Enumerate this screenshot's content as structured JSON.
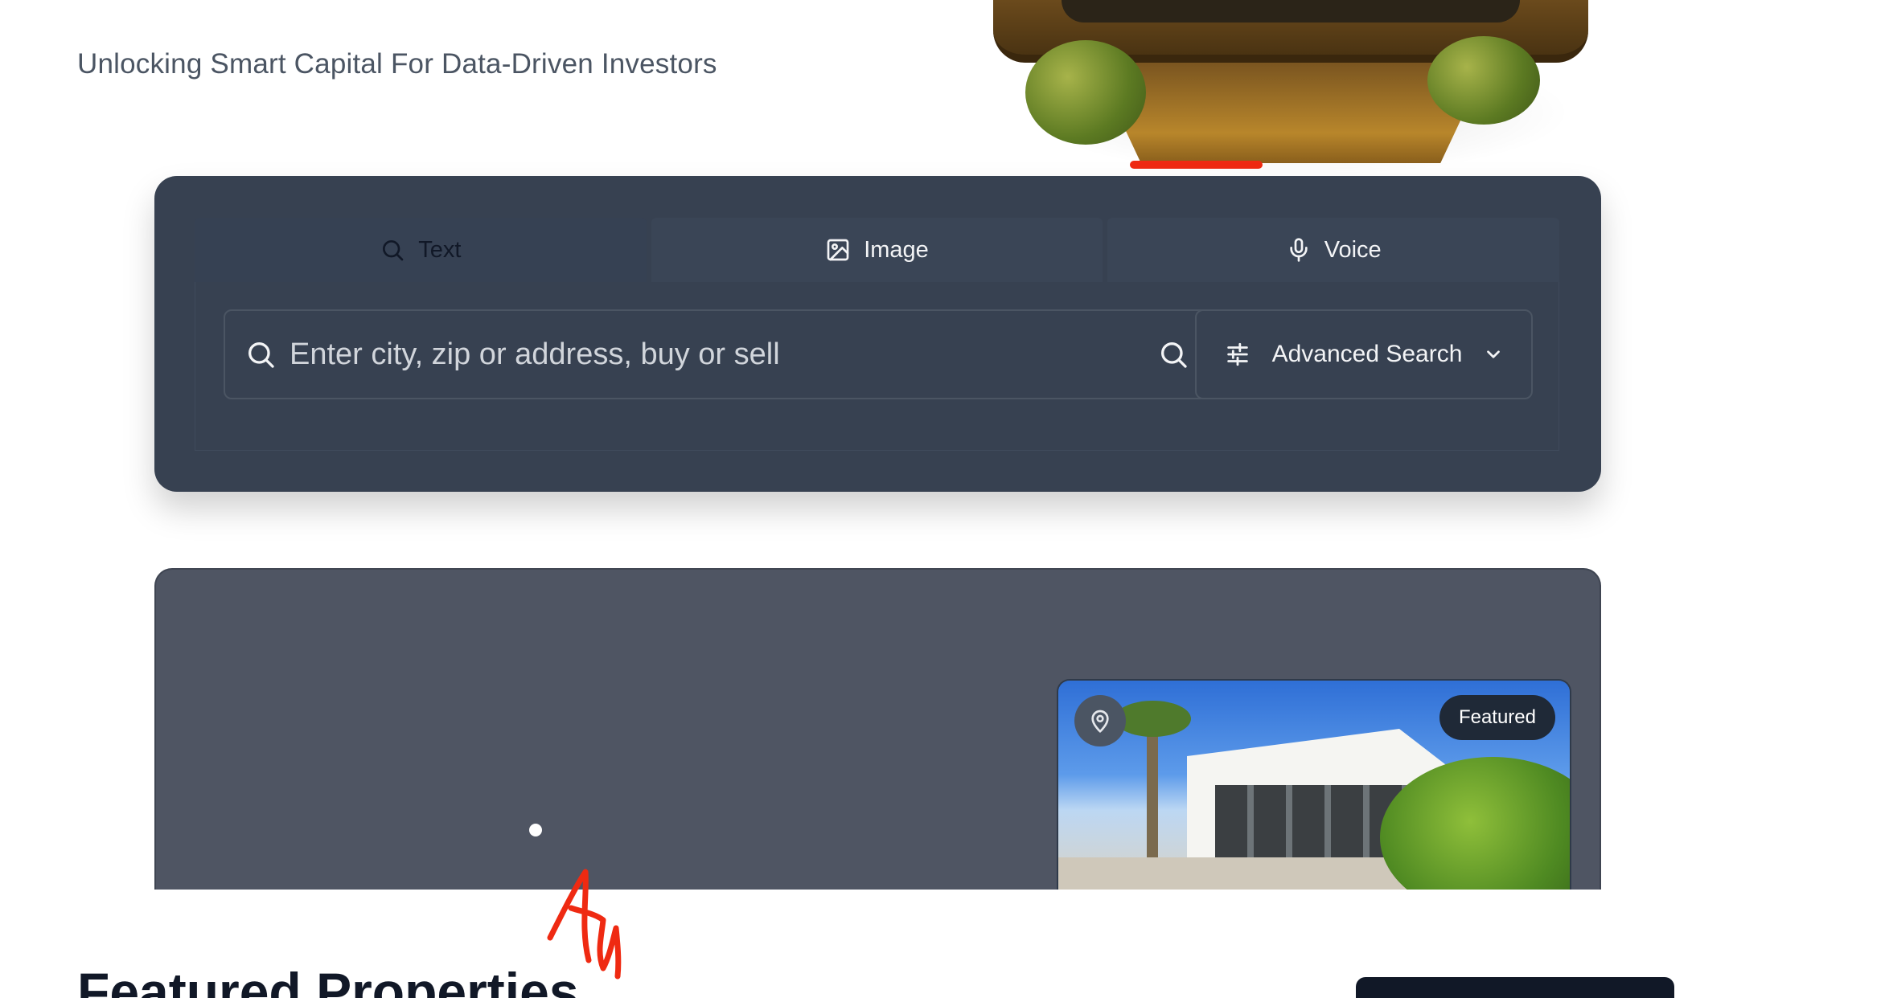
{
  "hero": {
    "subtitle": "Unlocking Smart Capital For Data-Driven Investors"
  },
  "search": {
    "tabs": [
      {
        "label": "Text",
        "icon": "search-icon",
        "active": true
      },
      {
        "label": "Image",
        "icon": "image-icon",
        "active": false
      },
      {
        "label": "Voice",
        "icon": "microphone-icon",
        "active": false
      }
    ],
    "placeholder": "Enter city, zip or address, buy or sell",
    "advanced_label": "Advanced Search"
  },
  "banner": {
    "property_card": {
      "badge": "Featured"
    }
  },
  "featured": {
    "title": "Featured Properties"
  },
  "colors": {
    "card_bg": "#374151",
    "banner_bg": "#4f5563",
    "annotation_red": "#ef2a12"
  }
}
